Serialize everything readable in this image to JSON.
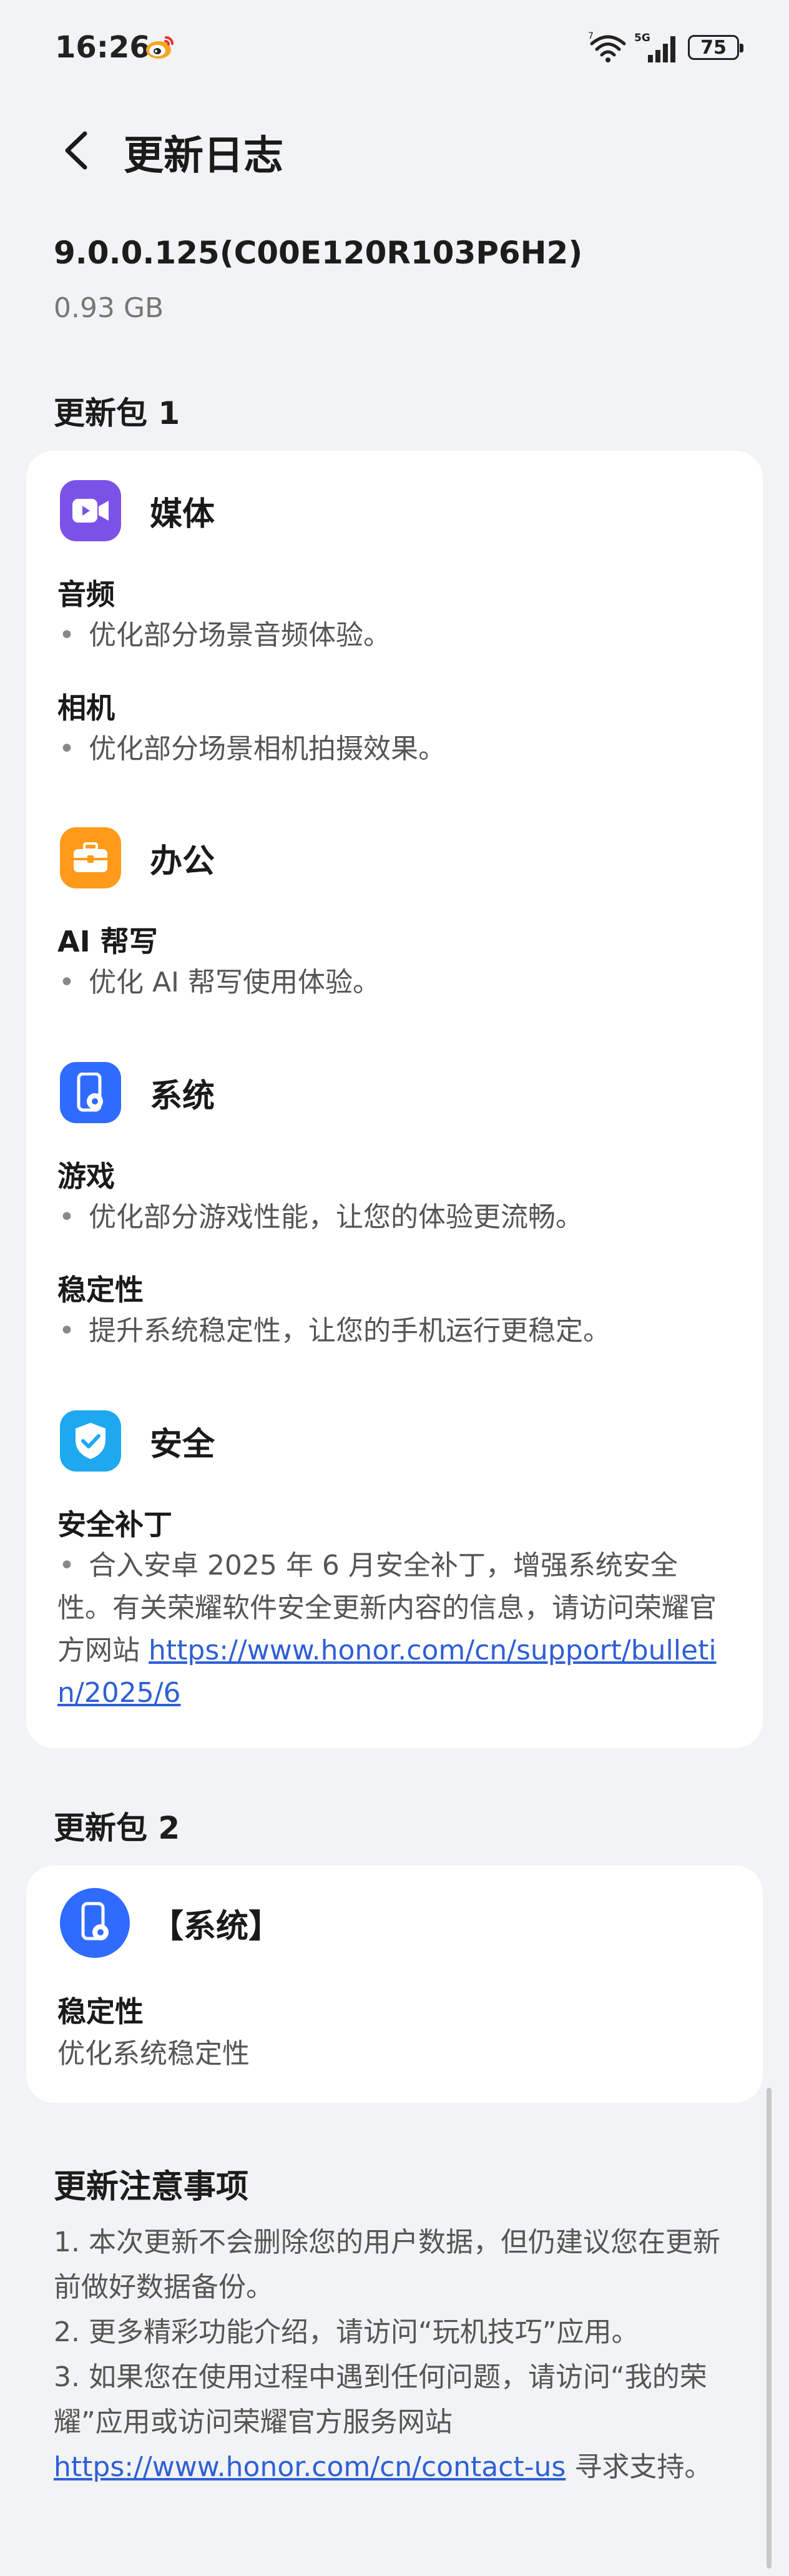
{
  "status": {
    "time": "16:26",
    "network_label": "5G",
    "wifi_label": "7",
    "battery": "75"
  },
  "header": {
    "title": "更新日志"
  },
  "version": {
    "name": "9.0.0.125(C00E120R103P6H2)",
    "size": "0.93 GB"
  },
  "package1": {
    "title": "更新包 1",
    "categories": [
      {
        "label": "媒体",
        "icon": "video-camera-icon",
        "color": "#7b52e8",
        "items": [
          {
            "head": "音频",
            "text": "优化部分场景音频体验。"
          },
          {
            "head": "相机",
            "text": "优化部分场景相机拍摄效果。"
          }
        ]
      },
      {
        "label": "办公",
        "icon": "briefcase-icon",
        "color": "#ff9a1a",
        "items": [
          {
            "head": "AI 帮写",
            "text": "优化 AI 帮写使用体验。"
          }
        ]
      },
      {
        "label": "系统",
        "icon": "phone-settings-icon",
        "color": "#2f6bff",
        "items": [
          {
            "head": "游戏",
            "text": "优化部分游戏性能，让您的体验更流畅。"
          },
          {
            "head": "稳定性",
            "text": "提升系统稳定性，让您的手机运行更稳定。"
          }
        ]
      },
      {
        "label": "安全",
        "icon": "shield-check-icon",
        "color": "#1ea8f0",
        "items": [
          {
            "head": "安全补丁",
            "text": "合入安卓 2025 年 6 月安全补丁，增强系统安全性。有关荣耀软件安全更新内容的信息，请访问荣耀官方网站 ",
            "link": "https://www.honor.com/cn/support/bulletin/2025/6"
          }
        ]
      }
    ]
  },
  "package2": {
    "title": "更新包 2",
    "category": {
      "label": "【系统】",
      "icon": "phone-settings-icon",
      "color": "#2f6bff"
    },
    "item": {
      "head": "稳定性",
      "text": "优化系统稳定性"
    }
  },
  "notes": {
    "title": "更新注意事项",
    "line1": "1. 本次更新不会删除您的用户数据，但仍建议您在更新前做好数据备份。",
    "line2": "2. 更多精彩功能介绍，请访问“玩机技巧”应用。",
    "line3": "3. 如果您在使用过程中遇到任何问题，请访问“我的荣耀”应用或访问荣耀官方服务网站 ",
    "link": "https://www.honor.com/cn/contact-us",
    "line3_end": " 寻求支持。"
  }
}
